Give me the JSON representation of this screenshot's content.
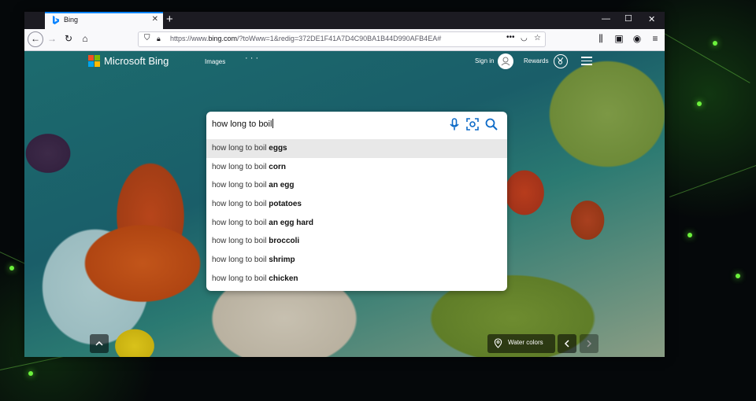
{
  "browser": {
    "tab_title": "Bing",
    "url_prefix": "https://www.",
    "url_domain": "bing.com",
    "url_rest": "/?toWww=1&redig=372DE1F41A7D4C90BA1B44D990AFB4EA#"
  },
  "bing": {
    "logo_text": "Microsoft Bing",
    "images_link": "Images",
    "more_link": "· · ·",
    "sign_in": "Sign in",
    "rewards": "Rewards",
    "colors": {
      "logo_red": "#f25022",
      "logo_green": "#7fba00",
      "logo_blue": "#00a4ef",
      "logo_yellow": "#ffb900",
      "search_icon": "#0c6ac7"
    }
  },
  "search": {
    "query": "how long to boil",
    "suggestions": [
      {
        "prefix": "how long to boil ",
        "suffix": "eggs"
      },
      {
        "prefix": "how long to boil ",
        "suffix": "corn"
      },
      {
        "prefix": "how long to boil ",
        "suffix": "an egg"
      },
      {
        "prefix": "how long to boil ",
        "suffix": "potatoes"
      },
      {
        "prefix": "how long to boil ",
        "suffix": "an egg hard"
      },
      {
        "prefix": "how long to boil ",
        "suffix": "broccoli"
      },
      {
        "prefix": "how long to boil ",
        "suffix": "shrimp"
      },
      {
        "prefix": "how long to boil ",
        "suffix": "chicken"
      }
    ]
  },
  "footer": {
    "image_caption": "Water colors"
  },
  "icons": [
    "bing-icon",
    "close-icon",
    "plus-icon",
    "minimize-icon",
    "maximize-icon",
    "back-icon",
    "forward-icon",
    "reload-icon",
    "home-icon",
    "shield-icon",
    "lock-icon",
    "more-icon",
    "pocket-icon",
    "star-icon",
    "library-icon",
    "sidebar-icon",
    "account-icon",
    "menu-icon",
    "microphone-icon",
    "visual-search-icon",
    "search-icon",
    "avatar-icon",
    "medal-icon",
    "chevron-up-icon",
    "location-pin-icon",
    "chevron-left-icon",
    "chevron-right-icon"
  ]
}
